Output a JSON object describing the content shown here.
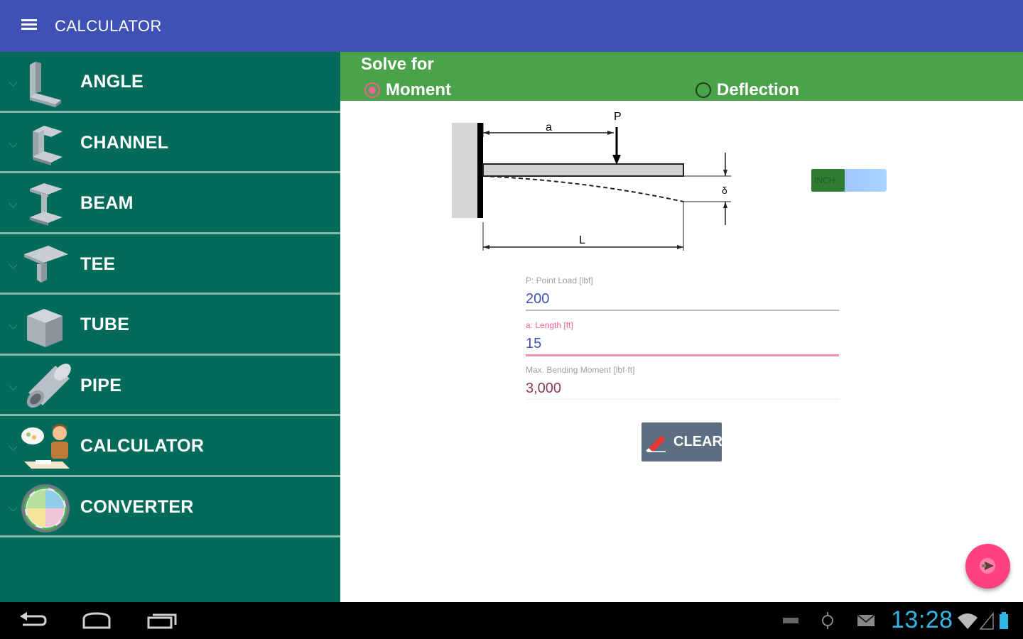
{
  "appbar": {
    "title": "CALCULATOR"
  },
  "sidebar": {
    "items": [
      {
        "label": "ANGLE",
        "icon": "angle-profile-icon"
      },
      {
        "label": "CHANNEL",
        "icon": "channel-profile-icon"
      },
      {
        "label": "BEAM",
        "icon": "beam-profile-icon"
      },
      {
        "label": "TEE",
        "icon": "tee-profile-icon"
      },
      {
        "label": "TUBE",
        "icon": "tube-profile-icon"
      },
      {
        "label": "PIPE",
        "icon": "pipe-profile-icon"
      },
      {
        "label": "CALCULATOR",
        "icon": "calculator-person-icon"
      },
      {
        "label": "CONVERTER",
        "icon": "converter-circle-icon"
      }
    ]
  },
  "solve": {
    "title": "Solve for",
    "options": [
      {
        "label": "Moment",
        "checked": true
      },
      {
        "label": "Deflection",
        "checked": false
      }
    ]
  },
  "diagram": {
    "load_label": "P",
    "a_label": "a",
    "deflection_label": "δ",
    "length_label": "L"
  },
  "unit_toggle": {
    "label": "INCH"
  },
  "fields": [
    {
      "label": "P: Point Load [lbf]",
      "value": "200"
    },
    {
      "label": "a: Length [ft]",
      "value": "15"
    },
    {
      "label": "Max. Bending Moment [lbf·ft]",
      "value": "3,000"
    }
  ],
  "clear_button": {
    "label": "CLEAR"
  },
  "statusbar": {
    "time": "13:28"
  },
  "colors": {
    "appbar": "#3f51b5",
    "sidebar": "#046b5a",
    "solve_bar": "#4aa34a",
    "accent": "#ff4081",
    "clock": "#33b5e5"
  }
}
